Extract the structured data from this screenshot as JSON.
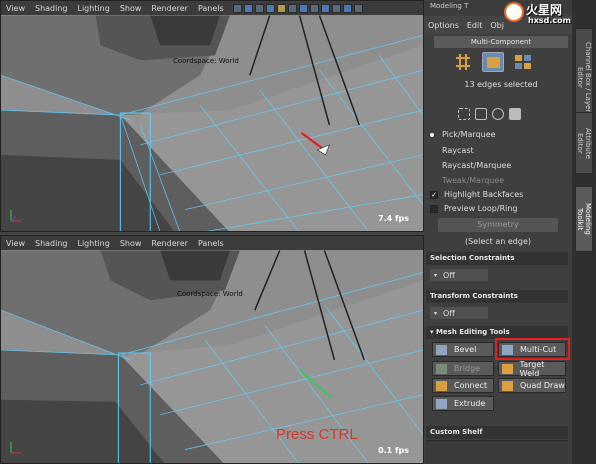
{
  "viewport_menu": [
    "View",
    "Shading",
    "Lighting",
    "Show",
    "Renderer",
    "Panels"
  ],
  "top_viewport": {
    "fps": "7.4 fps",
    "coord_label": "Coordspace: World"
  },
  "bottom_viewport": {
    "fps": "0.1 fps",
    "coord_label": "Coordspace: World",
    "annotation": "Press CTRL"
  },
  "panel": {
    "title": "Modeling T",
    "menu": [
      "Options",
      "Edit",
      "Obj"
    ],
    "multi_component": "Multi-Component",
    "edges_selected": "13 edges selected",
    "options": [
      "Pick/Marquee",
      "Raycast",
      "Raycast/Marquee",
      "Tweak/Marquee"
    ],
    "highlight_backfaces": "Highlight Backfaces",
    "preview_loop": "Preview Loop/Ring",
    "symmetry": "Symmetry",
    "select_edge": "(Select an edge)",
    "selection_constraints": "Selection Constraints",
    "transform_constraints": "Transform Constraints",
    "off": "Off",
    "mesh_editing_tools": "Mesh Editing Tools",
    "tools": [
      "Bevel",
      "Multi-Cut",
      "Bridge",
      "Target Weld",
      "Connect",
      "Quad Draw",
      "Extrude"
    ],
    "custom_shelf": "Custom Shelf"
  },
  "side_tabs": [
    "Channel Box / Layer Editor",
    "Attribute Editor",
    "Modeling Toolkit"
  ],
  "watermark": {
    "text": "火星网",
    "url": "hxsd.com"
  },
  "colors": {
    "highlight": "#e02020",
    "annotation": "#d23a2a",
    "wire": "#5fd0ff"
  }
}
